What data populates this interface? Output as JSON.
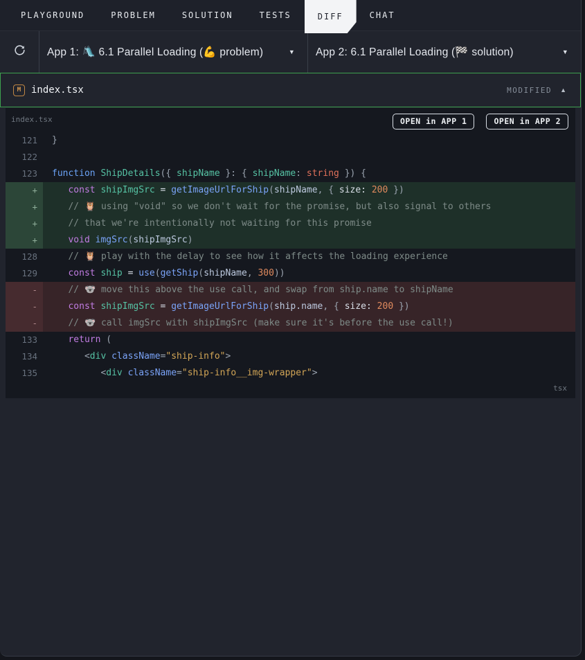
{
  "tabs": {
    "items": [
      {
        "label": "PLAYGROUND"
      },
      {
        "label": "PROBLEM"
      },
      {
        "label": "SOLUTION"
      },
      {
        "label": "TESTS"
      },
      {
        "label": "DIFF"
      },
      {
        "label": "CHAT"
      }
    ]
  },
  "toolbar": {
    "app1_label": "App 1: 🛝 6.1 Parallel Loading (💪 problem)",
    "app2_label": "App 2: 6.1 Parallel Loading (🏁 solution)",
    "caret": "▼"
  },
  "diff": {
    "badge": "M",
    "file": "index.tsx",
    "status": "MODIFIED",
    "collapse_icon": "▲"
  },
  "code": {
    "filename_label": "index.tsx",
    "open_app1": "OPEN in APP 1",
    "open_app2": "OPEN in APP 2",
    "lang_label": "tsx",
    "lines": [
      {
        "gutter": "121",
        "type": "ctx",
        "segs": [
          [
            "p",
            "}"
          ]
        ]
      },
      {
        "gutter": "122",
        "type": "ctx",
        "segs": []
      },
      {
        "gutter": "123",
        "type": "ctx",
        "segs": [
          [
            "kb",
            "function "
          ],
          [
            "d",
            "ShipDetails"
          ],
          [
            "p",
            "({ "
          ],
          [
            "d",
            "shipName"
          ],
          [
            "p",
            " }: { "
          ],
          [
            "d",
            "shipName"
          ],
          [
            "p",
            ": "
          ],
          [
            "t",
            "string"
          ],
          [
            "p",
            " }) {"
          ]
        ]
      },
      {
        "gutter": "+",
        "type": "add",
        "segs": [
          [
            "w",
            "   "
          ],
          [
            "k",
            "const "
          ],
          [
            "d",
            "shipImgSrc"
          ],
          [
            "w",
            " = "
          ],
          [
            "f",
            "getImageUrlForShip"
          ],
          [
            "p",
            "("
          ],
          [
            "v",
            "shipName"
          ],
          [
            "p",
            ", { "
          ],
          [
            "w",
            "size: "
          ],
          [
            "n",
            "200"
          ],
          [
            "p",
            " })"
          ]
        ]
      },
      {
        "gutter": "+",
        "type": "add",
        "segs": [
          [
            "w",
            "   "
          ],
          [
            "c",
            "// 🦉 using \"void\" so we don't wait for the promise, but also signal to others"
          ]
        ]
      },
      {
        "gutter": "+",
        "type": "add",
        "segs": [
          [
            "w",
            "   "
          ],
          [
            "c",
            "// that we're intentionally not waiting for this promise"
          ]
        ]
      },
      {
        "gutter": "+",
        "type": "add",
        "segs": [
          [
            "w",
            "   "
          ],
          [
            "k",
            "void "
          ],
          [
            "f",
            "imgSrc"
          ],
          [
            "p",
            "("
          ],
          [
            "v",
            "shipImgSrc"
          ],
          [
            "p",
            ")"
          ]
        ]
      },
      {
        "gutter": "128",
        "type": "ctx",
        "segs": [
          [
            "w",
            "   "
          ],
          [
            "c",
            "// 🦉 play with the delay to see how it affects the loading experience"
          ]
        ]
      },
      {
        "gutter": "129",
        "type": "ctx",
        "segs": [
          [
            "w",
            "   "
          ],
          [
            "k",
            "const "
          ],
          [
            "d",
            "ship"
          ],
          [
            "w",
            " = "
          ],
          [
            "f",
            "use"
          ],
          [
            "p",
            "("
          ],
          [
            "f",
            "getShip"
          ],
          [
            "p",
            "("
          ],
          [
            "v",
            "shipName"
          ],
          [
            "p",
            ", "
          ],
          [
            "n",
            "300"
          ],
          [
            "p",
            "))"
          ]
        ]
      },
      {
        "gutter": "-",
        "type": "del",
        "segs": [
          [
            "w",
            "   "
          ],
          [
            "c",
            "// 🐨 move this above the use call, and swap from ship.name to shipName"
          ]
        ]
      },
      {
        "gutter": "-",
        "type": "del",
        "segs": [
          [
            "w",
            "   "
          ],
          [
            "k",
            "const "
          ],
          [
            "d",
            "shipImgSrc"
          ],
          [
            "w",
            " = "
          ],
          [
            "f",
            "getImageUrlForShip"
          ],
          [
            "p",
            "("
          ],
          [
            "v",
            "ship.name"
          ],
          [
            "p",
            ", { "
          ],
          [
            "w",
            "size: "
          ],
          [
            "n",
            "200"
          ],
          [
            "p",
            " })"
          ]
        ]
      },
      {
        "gutter": "-",
        "type": "del",
        "segs": [
          [
            "w",
            "   "
          ],
          [
            "c",
            "// 🐨 call imgSrc with shipImgSrc (make sure it's before the use call!)"
          ]
        ]
      },
      {
        "gutter": "133",
        "type": "ctx",
        "segs": [
          [
            "w",
            "   "
          ],
          [
            "k",
            "return "
          ],
          [
            "p",
            "("
          ]
        ]
      },
      {
        "gutter": "134",
        "type": "ctx",
        "segs": [
          [
            "w",
            "      "
          ],
          [
            "p",
            "<"
          ],
          [
            "d",
            "div"
          ],
          [
            "w",
            " "
          ],
          [
            "f",
            "className"
          ],
          [
            "p",
            "="
          ],
          [
            "s",
            "\"ship-info\""
          ],
          [
            "p",
            ">"
          ]
        ]
      },
      {
        "gutter": "135",
        "type": "ctx",
        "segs": [
          [
            "w",
            "         "
          ],
          [
            "p",
            "<"
          ],
          [
            "d",
            "div"
          ],
          [
            "w",
            " "
          ],
          [
            "f",
            "className"
          ],
          [
            "p",
            "="
          ],
          [
            "s",
            "\"ship-info__img-wrapper\""
          ],
          [
            "p",
            ">"
          ]
        ]
      }
    ]
  }
}
